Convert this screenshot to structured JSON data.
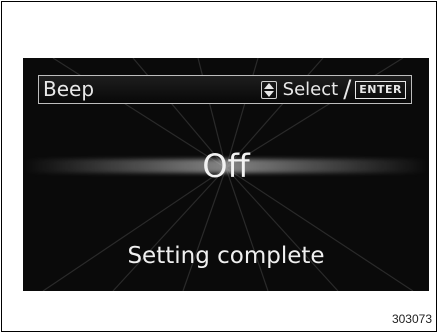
{
  "display": {
    "setting_title": "Beep",
    "select_label": "Select",
    "slash": "/",
    "enter_label": "ENTER",
    "value": "Off",
    "status": "Setting complete"
  },
  "icons": {
    "up_down": "up-down-arrows-icon"
  },
  "figure_code": "303073"
}
